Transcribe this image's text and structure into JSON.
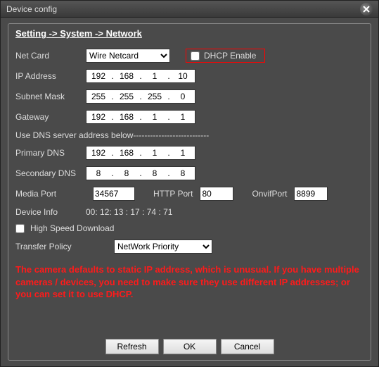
{
  "window": {
    "title": "Device config"
  },
  "breadcrumb": "Setting -> System -> Network",
  "labels": {
    "net_card": "Net Card",
    "dhcp_enable": "DHCP Enable",
    "ip_address": "IP Address",
    "subnet_mask": "Subnet Mask",
    "gateway": "Gateway",
    "dns_section": "Use DNS server address below---------------------------",
    "primary_dns": "Primary DNS",
    "secondary_dns": "Secondary DNS",
    "media_port": "Media Port",
    "http_port": "HTTP Port",
    "onvif_port": "OnvifPort",
    "device_info": "Device Info",
    "high_speed": "High Speed Download",
    "transfer_policy": "Transfer Policy"
  },
  "values": {
    "net_card": "Wire Netcard",
    "dhcp_checked": false,
    "ip": {
      "a": "192",
      "b": "168",
      "c": "1",
      "d": "10"
    },
    "subnet": {
      "a": "255",
      "b": "255",
      "c": "255",
      "d": "0"
    },
    "gateway": {
      "a": "192",
      "b": "168",
      "c": "1",
      "d": "1"
    },
    "primary_dns": {
      "a": "192",
      "b": "168",
      "c": "1",
      "d": "1"
    },
    "secondary_dns": {
      "a": "8",
      "b": "8",
      "c": "8",
      "d": "8"
    },
    "media_port": "34567",
    "http_port": "80",
    "onvif_port": "8899",
    "device_info": "00: 12: 13 : 17 : 74 : 71",
    "high_speed_checked": false,
    "transfer_policy": "NetWork Priority"
  },
  "note": "The camera defaults to static IP address, which is unusual. If you have multiple cameras / devices, you need to make sure they use different IP addresses; or you can set it to use DHCP.",
  "buttons": {
    "refresh": "Refresh",
    "ok": "OK",
    "cancel": "Cancel"
  }
}
